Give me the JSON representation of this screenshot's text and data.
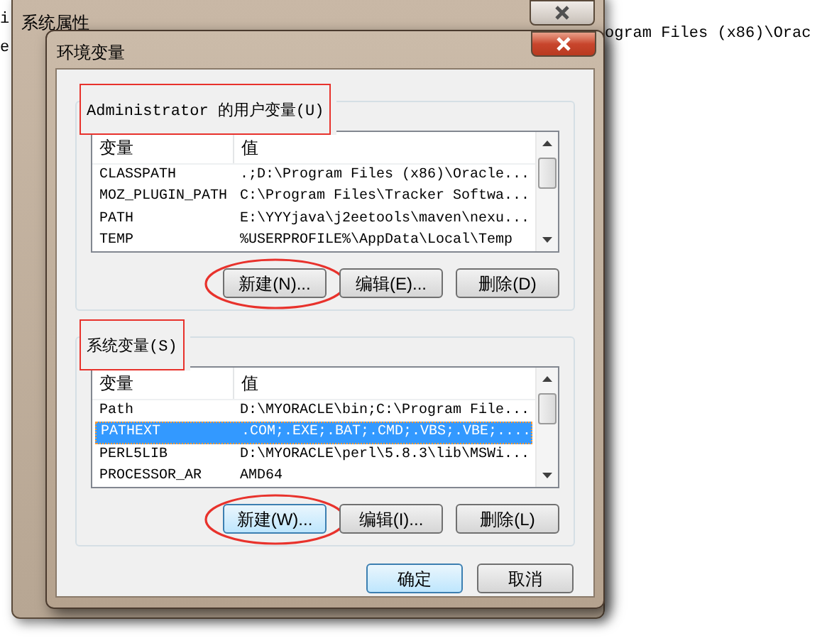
{
  "background_text": [
    {
      "text": "i",
      "kind": "left"
    },
    {
      "text": "ogram Files (x86)\\Orac",
      "kind": "right"
    },
    {
      "text": "e",
      "kind": "left"
    }
  ],
  "parent_window": {
    "title": "系统属性"
  },
  "dialog": {
    "title": "环境变量",
    "groups": [
      {
        "label": "Administrator 的用户变量(U)",
        "highlighted": true,
        "columns": [
          "变量",
          "值"
        ],
        "rows": [
          {
            "name": "CLASSPATH",
            "value": ".;D:\\Program Files (x86)\\Oracle...",
            "selected": false
          },
          {
            "name": "MOZ_PLUGIN_PATH",
            "value": "C:\\Program Files\\Tracker Softwa...",
            "selected": false
          },
          {
            "name": "PATH",
            "value": "E:\\YYYjava\\j2eetools\\maven\\nexu...",
            "selected": false
          },
          {
            "name": "TEMP",
            "value": "%USERPROFILE%\\AppData\\Local\\Temp",
            "selected": false
          }
        ],
        "buttons": [
          {
            "label": "新建(N)...",
            "circled": true,
            "hovered": false
          },
          {
            "label": "编辑(E)...",
            "circled": false,
            "hovered": false
          },
          {
            "label": "删除(D)",
            "circled": false,
            "hovered": false
          }
        ]
      },
      {
        "label": "系统变量(S)",
        "highlighted": true,
        "columns": [
          "变量",
          "值"
        ],
        "rows": [
          {
            "name": "Path",
            "value": "D:\\MYORACLE\\bin;C:\\Program File...",
            "selected": false
          },
          {
            "name": "PATHEXT",
            "value": ".COM;.EXE;.BAT;.CMD;.VBS;.VBE;....",
            "selected": true
          },
          {
            "name": "PERL5LIB",
            "value": "D:\\MYORACLE\\perl\\5.8.3\\lib\\MSWi...",
            "selected": false
          },
          {
            "name": "PROCESSOR_AR",
            "value": "AMD64",
            "selected": false
          }
        ],
        "buttons": [
          {
            "label": "新建(W)...",
            "circled": true,
            "hovered": true
          },
          {
            "label": "编辑(I)...",
            "circled": false,
            "hovered": false
          },
          {
            "label": "删除(L)",
            "circled": false,
            "hovered": false
          }
        ]
      }
    ],
    "buttons": [
      {
        "label": "确定",
        "focused": true
      },
      {
        "label": "取消",
        "focused": false
      }
    ]
  }
}
